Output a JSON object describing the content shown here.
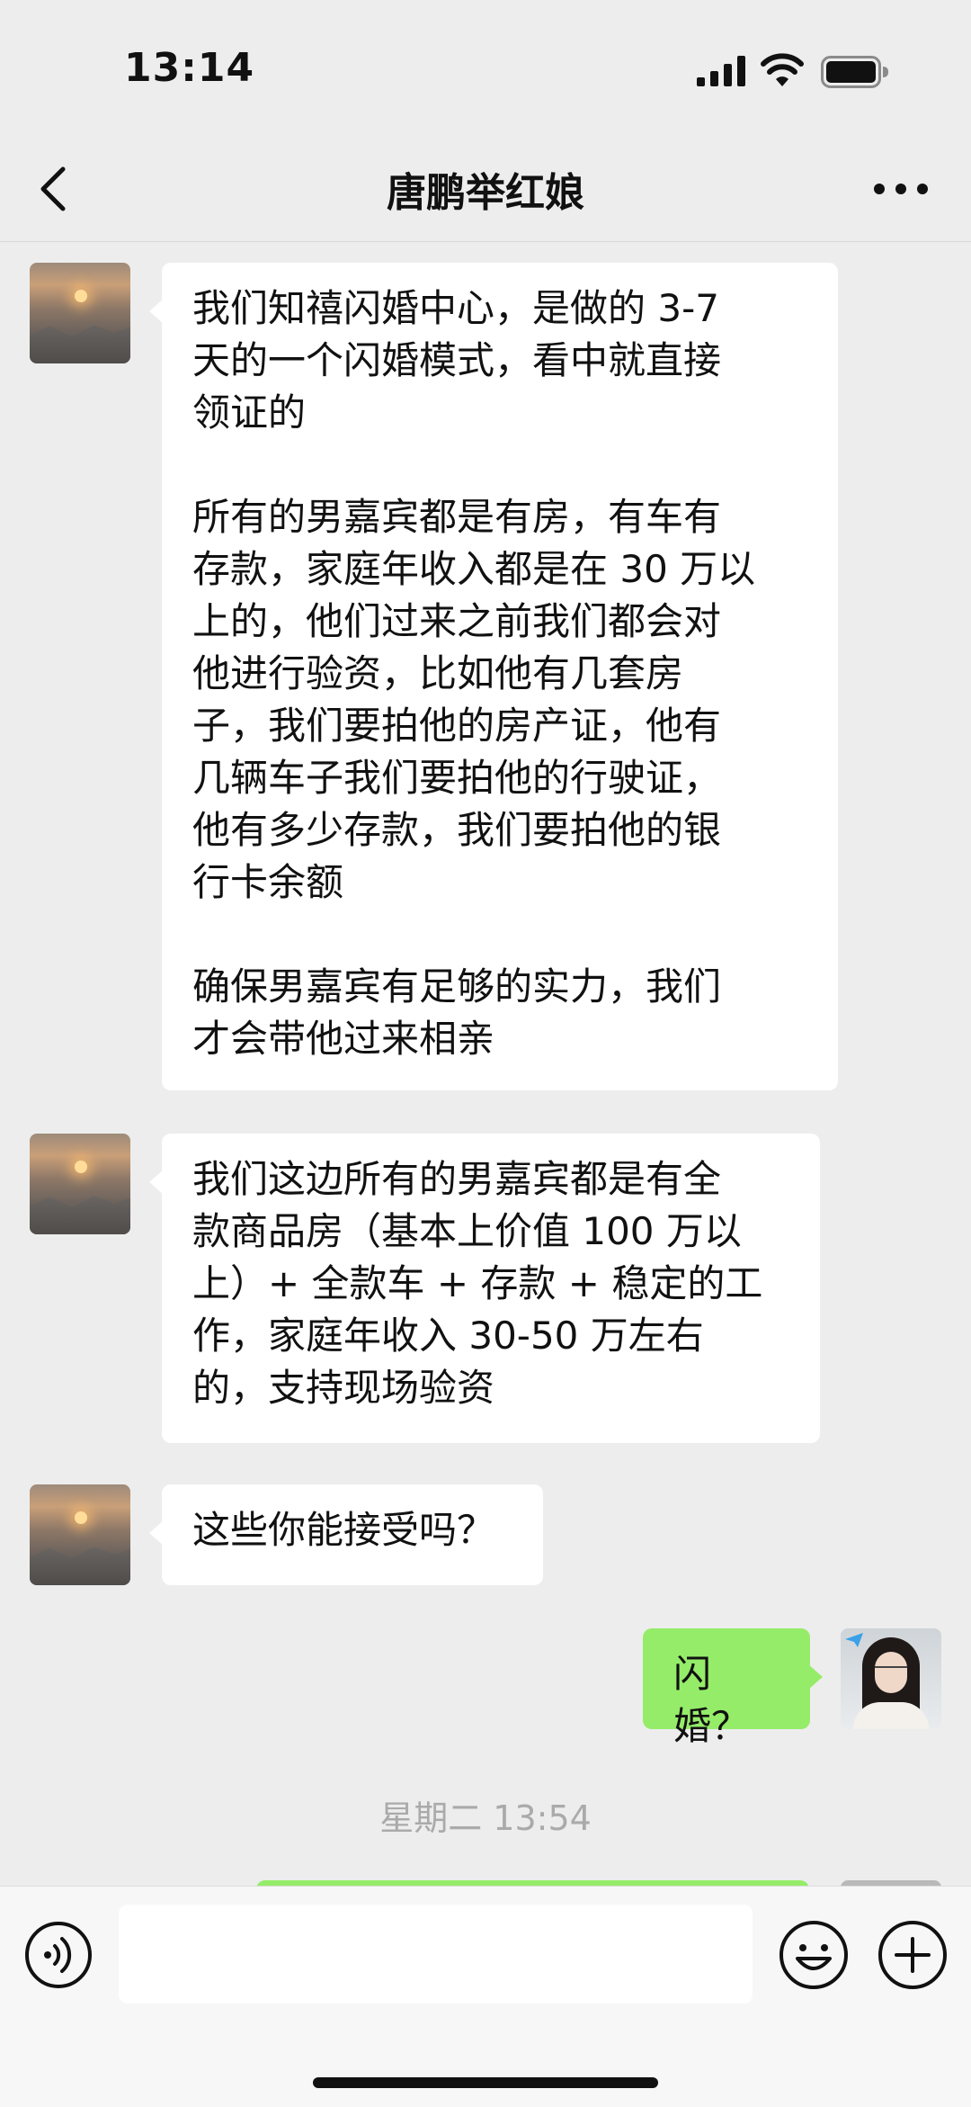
{
  "status_bar": {
    "time": "13:14"
  },
  "nav": {
    "title": "唐鹏举红娘"
  },
  "messages": [
    {
      "sender": "contact",
      "text": "我们知禧闪婚中心，是做的 3-7\n天的一个闪婚模式，看中就直接\n领证的\n\n所有的男嘉宾都是有房，有车有\n存款，家庭年收入都是在 30 万以\n上的，他们过来之前我们都会对\n他进行验资，比如他有几套房\n子，我们要拍他的房产证，他有\n几辆车子我们要拍他的行驶证，\n他有多少存款，我们要拍他的银\n行卡余额\n\n确保男嘉宾有足够的实力，我们\n才会带他过来相亲"
    },
    {
      "sender": "contact",
      "text": "我们这边所有的男嘉宾都是有全\n款商品房（基本上价值 100 万以\n上）+ 全款车 + 存款 + 稳定的工\n作，家庭年收入 30-50 万左右\n的，支持现场验资"
    },
    {
      "sender": "contact",
      "text": "这些你能接受吗？"
    },
    {
      "sender": "me",
      "text": "闪婚？"
    }
  ],
  "timestamp": "星期二 13:54",
  "input": {
    "value": ""
  },
  "colors": {
    "background": "#ededed",
    "incoming_bubble": "#ffffff",
    "outgoing_bubble": "#95ec69",
    "timestamp_text": "#aaaaaa"
  },
  "icons": [
    "back-arrow-icon",
    "more-dots-icon",
    "voice-icon",
    "emoji-icon",
    "plus-icon",
    "signal-icon",
    "wifi-icon",
    "battery-icon"
  ]
}
